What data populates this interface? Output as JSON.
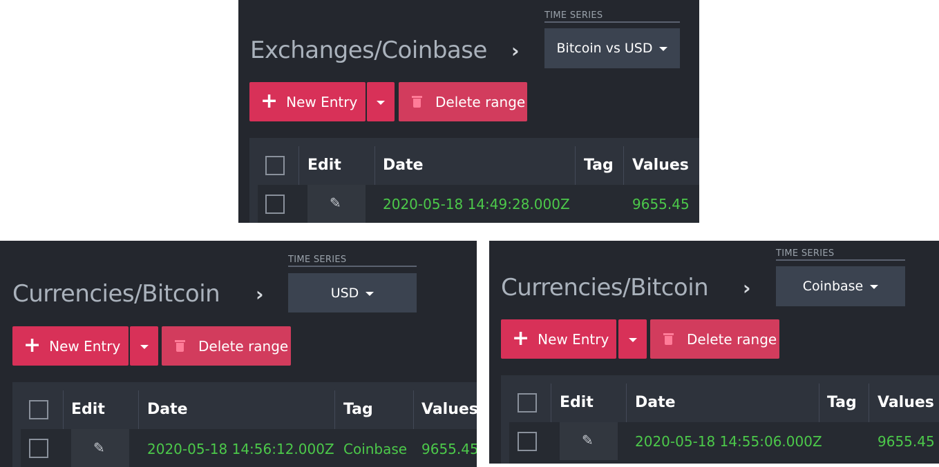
{
  "panels": {
    "top": {
      "title": "Exchanges/Coinbase",
      "chevron": "›",
      "time_series_label": "TIME SERIES",
      "time_series_value": "Bitcoin vs USD",
      "new_entry_label": "New Entry",
      "delete_range_label": "Delete range",
      "columns": [
        "Edit",
        "Date",
        "Tag",
        "Values"
      ],
      "row": {
        "date": "2020-05-18 14:49:28.000Z",
        "tag": "",
        "value": "9655.45"
      }
    },
    "bottom_left": {
      "title": "Currencies/Bitcoin",
      "chevron": "›",
      "time_series_label": "TIME SERIES",
      "time_series_value": "USD",
      "new_entry_label": "New Entry",
      "delete_range_label": "Delete range",
      "columns": [
        "Edit",
        "Date",
        "Tag",
        "Values"
      ],
      "row": {
        "date": "2020-05-18 14:56:12.000Z",
        "tag": "Coinbase",
        "value": "9655.45"
      }
    },
    "bottom_right": {
      "title": "Currencies/Bitcoin",
      "chevron": "›",
      "time_series_label": "TIME SERIES",
      "time_series_value": "Coinbase",
      "new_entry_label": "New Entry",
      "delete_range_label": "Delete range",
      "columns": [
        "Edit",
        "Date",
        "Tag",
        "Values"
      ],
      "row": {
        "date": "2020-05-18 14:55:06.000Z",
        "tag": "",
        "value": "9655.45"
      }
    }
  },
  "colors": {
    "panel_bg": "#24272e",
    "accent_red": "#d83158",
    "select_bg": "#3b4350",
    "value_green": "#4cc94a"
  },
  "icons": [
    "chevron-right-icon",
    "plus-icon",
    "caret-down-icon",
    "trash-icon",
    "pencil-icon",
    "checkbox-icon"
  ]
}
